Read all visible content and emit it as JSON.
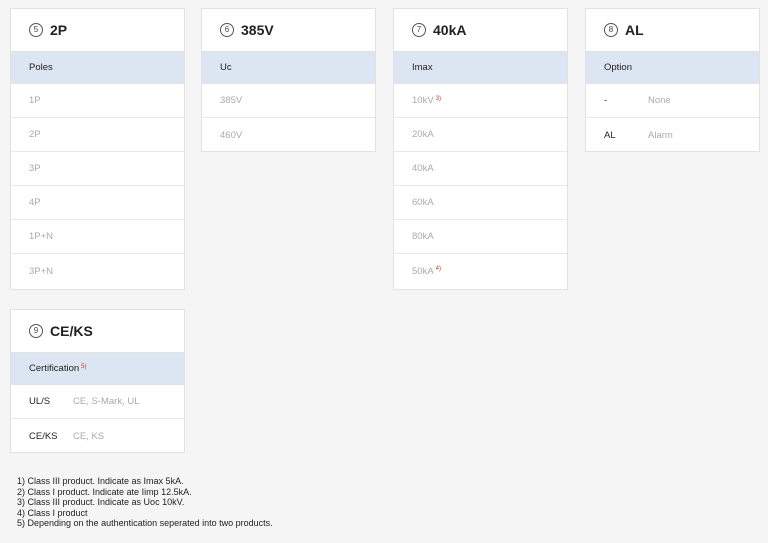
{
  "cards": {
    "poles": {
      "num": "5",
      "title": "2P",
      "header": "Poles",
      "rows": [
        "1P",
        "2P",
        "3P",
        "4P",
        "1P+N",
        "3P+N"
      ]
    },
    "uc": {
      "num": "6",
      "title": "385V",
      "header": "Uc",
      "rows": [
        "385V",
        "460V"
      ]
    },
    "imax": {
      "num": "7",
      "title": "40kA",
      "header": "Imax",
      "rows": [
        "10kV",
        "20kA",
        "40kA",
        "60kA",
        "80kA",
        "50kA"
      ],
      "notes": {
        "row0": "3)",
        "row5": "4)"
      }
    },
    "option": {
      "num": "8",
      "title": "AL",
      "header": "Option",
      "rows": [
        {
          "code": "-",
          "desc": "None"
        },
        {
          "code": "AL",
          "desc": "Alarm"
        }
      ]
    },
    "cert": {
      "num": "9",
      "title": "CE/KS",
      "header": "Certification",
      "header_note": "5)",
      "rows": [
        {
          "code": "UL/S",
          "desc": "CE, S-Mark, UL"
        },
        {
          "code": "CE/KS",
          "desc": "CE, KS"
        }
      ]
    }
  },
  "footnotes": [
    "1) Class III product. Indicate as Imax 5kA.",
    "2) Class I product. Indicate ate Iimp 12.5kA.",
    "3) Class III product. Indicate as Uoc 10kV.",
    "4) Class I product",
    "5) Depending on the authentication seperated into two products."
  ]
}
